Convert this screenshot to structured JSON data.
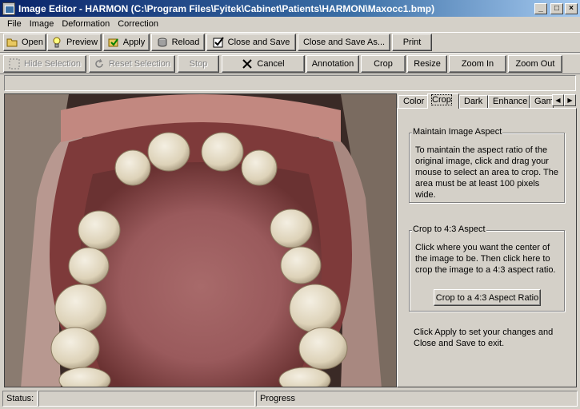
{
  "window": {
    "title": "Image Editor -  HARMON (C:\\Program Files\\Fyitek\\Cabinet\\Patients\\HARMON\\Maxocc1.bmp)",
    "minimize": "_",
    "maximize": "□",
    "close": "×"
  },
  "menu": [
    "File",
    "Image",
    "Deformation",
    "Correction"
  ],
  "toolbar1": {
    "open": "Open",
    "preview": "Preview",
    "apply": "Apply",
    "reload": "Reload",
    "close_save": "Close and Save",
    "close_save_as": "Close and Save As...",
    "print": "Print"
  },
  "toolbar2": {
    "hide_selection": "Hide Selection",
    "reset_selection": "Reset Selection",
    "stop": "Stop",
    "cancel": "Cancel",
    "annotation": "Annotation",
    "crop": "Crop",
    "resize": "Resize",
    "zoom_in": "Zoom In",
    "zoom_out": "Zoom Out"
  },
  "tabs": [
    "Color",
    "Crop",
    "Dark",
    "Enhance",
    "Gamma"
  ],
  "active_tab": "Crop",
  "crop_panel": {
    "maintain_title": "Maintain Image Aspect",
    "maintain_text": "To maintain the aspect ratio of the original image, click and drag your mouse to select an area to crop.  The area must be at least 100 pixels wide.",
    "crop43_title": "Crop to 4:3 Aspect",
    "crop43_text": "Click where you want the center of the image to be.  Then click here to crop the image to a 4:3 aspect ratio.",
    "crop43_button": "Crop to a 4:3 Aspect Ratio",
    "footer_text": "Click Apply to set your changes and Close and Save to exit."
  },
  "status": {
    "status_label": "Status:",
    "progress_label": "Progress"
  },
  "colors": {
    "face": "#d4d0c8",
    "title_start": "#0a246a",
    "title_end": "#a6caf0"
  }
}
